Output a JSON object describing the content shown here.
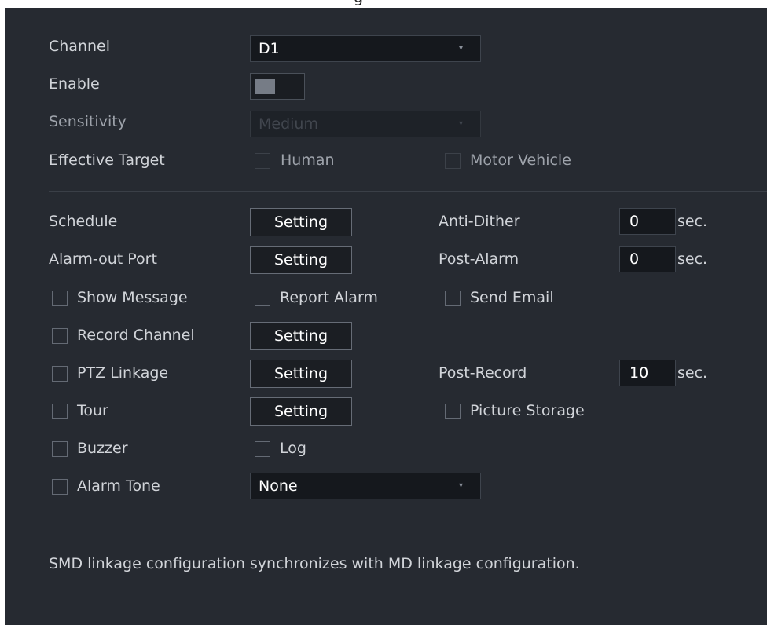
{
  "window": {
    "title_fragment": "g"
  },
  "fields": {
    "channel": {
      "label": "Channel",
      "value": "D1"
    },
    "enable": {
      "label": "Enable",
      "state": "off"
    },
    "sensitivity": {
      "label": "Sensitivity",
      "value": "Medium",
      "disabled": true
    },
    "effective_target": {
      "label": "Effective Target",
      "human_label": "Human",
      "motor_vehicle_label": "Motor Vehicle"
    }
  },
  "linkage": {
    "schedule_label": "Schedule",
    "alarm_out_port_label": "Alarm-out Port",
    "setting_label": "Setting",
    "anti_dither_label": "Anti-Dither",
    "anti_dither_value": "0",
    "post_alarm_label": "Post-Alarm",
    "post_alarm_value": "0",
    "sec_label": "sec.",
    "show_message_label": "Show Message",
    "report_alarm_label": "Report Alarm",
    "send_email_label": "Send Email",
    "record_channel_label": "Record Channel",
    "ptz_linkage_label": "PTZ Linkage",
    "post_record_label": "Post-Record",
    "post_record_value": "10",
    "tour_label": "Tour",
    "picture_storage_label": "Picture Storage",
    "buzzer_label": "Buzzer",
    "log_label": "Log",
    "alarm_tone_label": "Alarm Tone",
    "alarm_tone_value": "None"
  },
  "note": "SMD linkage configuration synchronizes with MD linkage configuration.",
  "icons": {
    "dropdown": "▾"
  },
  "colors": {
    "panel_bg": "#262a31",
    "text": "#d1d4d9",
    "input_bg": "#15181d"
  }
}
